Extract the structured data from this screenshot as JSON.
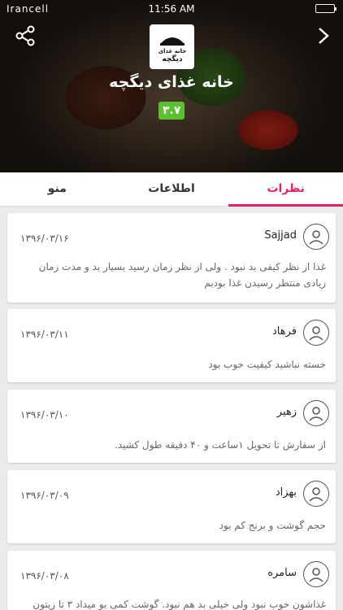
{
  "status_bar": {
    "carrier": "Irancell",
    "time": "11:56 AM"
  },
  "restaurant": {
    "name": "خانه غذای دیگچه",
    "logo_text_top": "خانه غذای",
    "logo_text_bottom": "دیگچه",
    "rating": "۳.۷"
  },
  "tabs": [
    {
      "label": "منو"
    },
    {
      "label": "اطلاعات"
    },
    {
      "label": "نظرات"
    }
  ],
  "reviews": [
    {
      "name": "Sajjad",
      "date": "۱۳۹۶/۰۳/۱۶",
      "text": "غذا از نظر کیفی بد نبود . ولی از نظر زمان رسید بسیار بد و مدت زمان زیادی منتظر رسیدن غذا بودیم"
    },
    {
      "name": "فرهاد",
      "date": "۱۳۹۶/۰۳/۱۱",
      "text": "خسته نباشید کیفیت خوب بود"
    },
    {
      "name": "زهیر",
      "date": "۱۳۹۶/۰۳/۱۰",
      "text": "از سفارش تا تحویل ۱ساعت و ۴۰ دقیقه طول کشید."
    },
    {
      "name": "بهزاد",
      "date": "۱۳۹۶/۰۳/۰۹",
      "text": "حجم گوشت و برنج کم بود"
    },
    {
      "name": "سامره",
      "date": "۱۳۹۶/۰۳/۰۸",
      "text": "غذاشون خوب نبود ولی خیلی بد هم نبود. گوشت کمی بو میداد ۳ تا زیتون"
    }
  ]
}
